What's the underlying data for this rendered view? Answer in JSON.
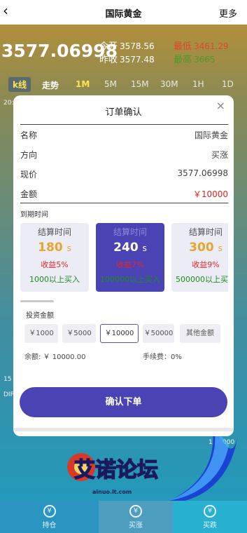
{
  "header": {
    "back_icon": "‹",
    "title": "国际黄金",
    "more_label": "更多"
  },
  "quote": {
    "price": "3577.06998",
    "open_label": "今开",
    "open_value": "3578.56",
    "prev_close_label": "昨收",
    "prev_close_value": "3577.48",
    "low_label": "最低",
    "low_value": "3461.29",
    "high_label": "最高",
    "high_value": "3665"
  },
  "periods": [
    "k线",
    "走势",
    "1M",
    "5M",
    "15M",
    "30M",
    "1H",
    "1D"
  ],
  "side_labels": {
    "left_top": "20:",
    "left_bottom_a": "15",
    "left_bottom_b": "DIF",
    "right_bottom": "1,00000"
  },
  "modal": {
    "title": "订单确认",
    "close_icon": "×",
    "rows": [
      {
        "label": "名称",
        "value": "国际黄金"
      },
      {
        "label": "方向",
        "value": "买涨"
      },
      {
        "label": "现价",
        "value": "3577.06998"
      },
      {
        "label": "金额",
        "value": "￥10000"
      }
    ],
    "expiry_label": "到期时间",
    "cards": [
      {
        "title": "结算时间",
        "duration": "180",
        "unit": "s",
        "yield": "收益5%",
        "min": "1000以上买入"
      },
      {
        "title": "结算时间",
        "duration": "240",
        "unit": "s",
        "yield": "收益7%",
        "min": "100000以上买入"
      },
      {
        "title": "结算时间",
        "duration": "300",
        "unit": "s",
        "yield": "收益9%",
        "min": "500000以上买入"
      }
    ],
    "amount_label": "投资金额",
    "amounts": [
      "￥1000",
      "￥5000",
      "￥10000",
      "￥50000",
      "其他金额"
    ],
    "balance": "余额: ￥ 10000.00",
    "fee": "手续费：0%",
    "confirm_label": "确认下单"
  },
  "logo": {
    "text": "艾诺论坛",
    "url_text": "ainuo.lt.com"
  },
  "bottom_nav": [
    "持仓",
    "买涨",
    "买跌"
  ],
  "colors": {
    "accent": "#4a43b3",
    "gold": "#e6a62b",
    "red": "#e8242b",
    "green": "#1c8f1c"
  }
}
